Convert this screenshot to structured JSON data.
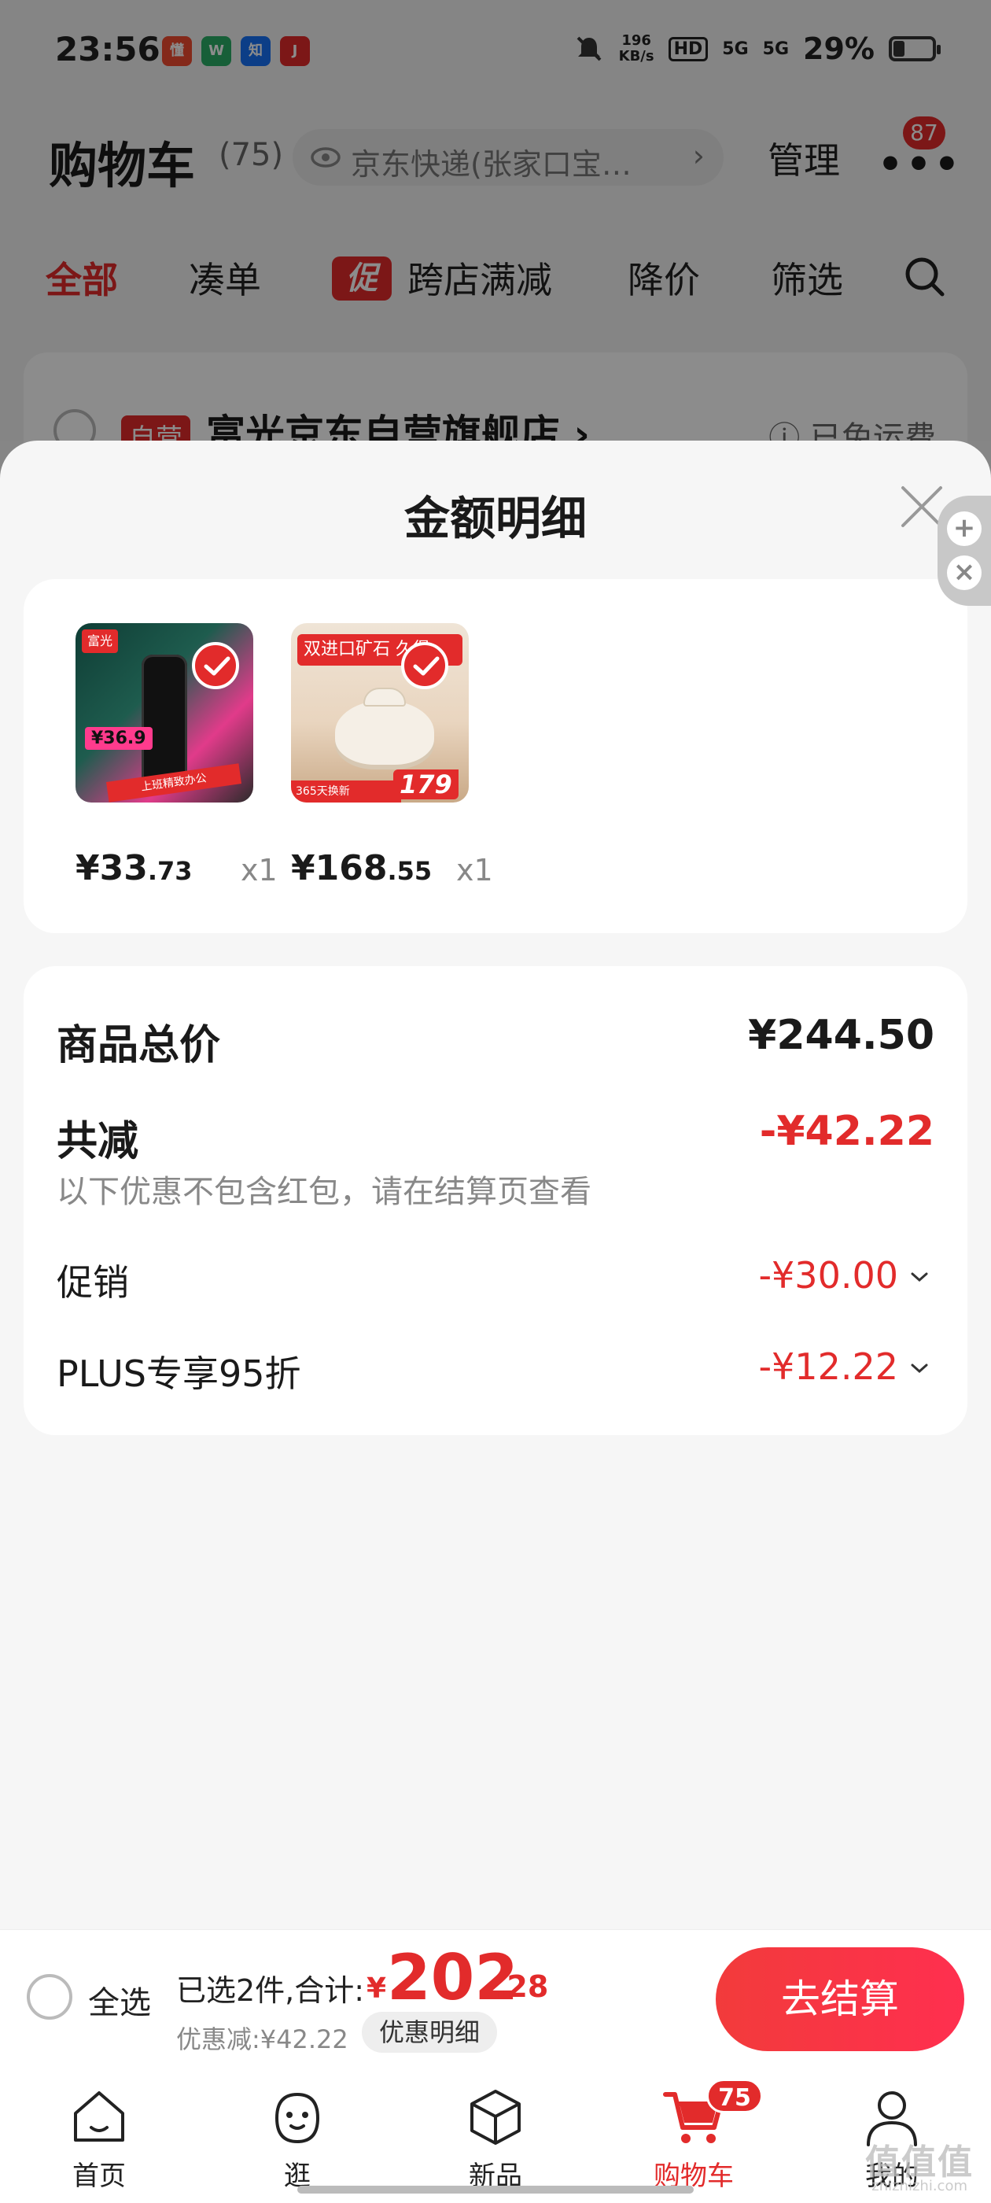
{
  "status_bar": {
    "time": "23:56",
    "net_speed_value": "196",
    "net_speed_unit": "KB/s",
    "hd_label": "HD",
    "signal_1": "5G",
    "signal_2": "5G",
    "battery": "29%"
  },
  "header": {
    "title": "购物车",
    "count": "(75)",
    "address": "京东快递(张家口宝…",
    "manage": "管理",
    "more_badge": "87"
  },
  "filter_tabs": {
    "all": "全部",
    "bundle": "凑单",
    "promo_tag": "促",
    "cross_store": "跨店满减",
    "price_drop": "降价",
    "filter": "筛选"
  },
  "store": {
    "tag": "自营",
    "name": "富光京东自营旗舰店 ›",
    "shipping": "ⓘ 已免运费"
  },
  "sheet": {
    "title": "金额明细",
    "products": [
      {
        "price_int": "¥33",
        "price_dec": ".73",
        "qty": "x1",
        "thumb_brand": "富光",
        "thumb_price": "¥36.9",
        "thumb_strip": "上班精致办公"
      },
      {
        "price_int": "¥168",
        "price_dec": ".55",
        "qty": "x1",
        "thumb_banner": "双进口矿石 久煲",
        "thumb_price": "179",
        "thumb_foot": "365天换新"
      }
    ],
    "summary": {
      "total_label": "商品总价",
      "total_value": "¥244.50",
      "reduce_label": "共减",
      "reduce_value": "-¥42.22",
      "reduce_note": "以下优惠不包含红包，请在结算页查看",
      "rows": [
        {
          "label": "促销",
          "value": "-¥30.00"
        },
        {
          "label": "PLUS专享95折",
          "value": "-¥12.22"
        }
      ]
    }
  },
  "checkout": {
    "select_all": "全选",
    "selected": "已选2件,合计:",
    "currency": "¥",
    "total_int": "202",
    "total_dec": ".28",
    "discount": "优惠减:¥42.22",
    "detail_button": "优惠明细",
    "checkout_button": "去结算"
  },
  "tab_bar": {
    "items": [
      {
        "label": "首页",
        "icon": "home-icon"
      },
      {
        "label": "逛",
        "icon": "stroll-icon"
      },
      {
        "label": "新品",
        "icon": "new-box-icon"
      },
      {
        "label": "购物车",
        "icon": "cart-icon",
        "badge": "75"
      },
      {
        "label": "我的",
        "icon": "person-icon"
      }
    ]
  },
  "watermark": {
    "text": "值值值",
    "sub": "zhizhizhi.com"
  },
  "colors": {
    "accent": "#e22b2b",
    "sheet_bg": "#f6f6f6",
    "card_bg": "#ffffff"
  }
}
